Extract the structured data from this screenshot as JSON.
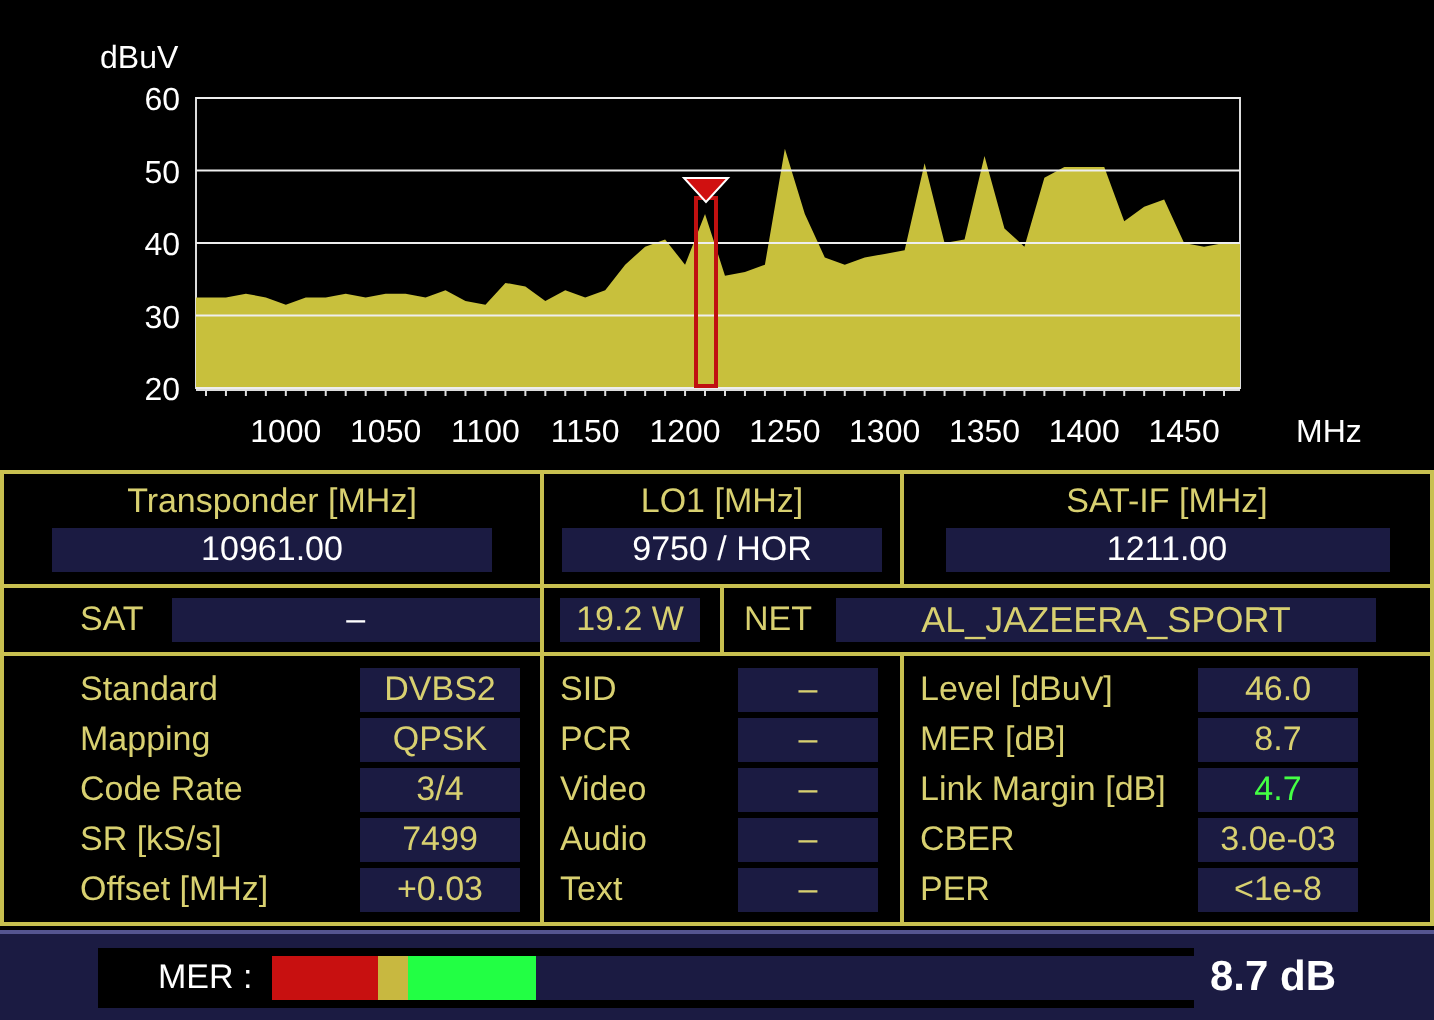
{
  "chart": {
    "chart_data": {
      "type": "area",
      "ylabel": "dBuV",
      "xlabel": "MHz",
      "x": [
        955,
        960,
        970,
        980,
        990,
        1000,
        1010,
        1020,
        1030,
        1040,
        1050,
        1060,
        1070,
        1080,
        1090,
        1100,
        1110,
        1120,
        1130,
        1140,
        1150,
        1160,
        1170,
        1180,
        1190,
        1200,
        1210,
        1220,
        1230,
        1240,
        1250,
        1260,
        1270,
        1280,
        1290,
        1300,
        1310,
        1320,
        1330,
        1340,
        1350,
        1360,
        1370,
        1380,
        1390,
        1400,
        1410,
        1420,
        1430,
        1440,
        1450,
        1460,
        1470,
        1478
      ],
      "series": [
        {
          "color": "#c8c03c",
          "values": [
            32.5,
            32.5,
            32.5,
            33,
            32.5,
            31.5,
            32.5,
            32.5,
            33,
            32.5,
            33,
            33,
            32.5,
            33.5,
            32,
            31.5,
            34.5,
            34,
            32,
            33.5,
            32.5,
            33.5,
            37,
            39.5,
            40.5,
            37,
            44,
            35.5,
            36,
            37,
            53,
            44,
            38,
            37,
            38,
            38.5,
            39,
            51,
            40,
            40.5,
            52,
            42,
            39.5,
            49,
            50.5,
            50.5,
            50.5,
            43,
            45,
            46,
            40,
            39.5,
            40,
            40
          ]
        }
      ],
      "grid": true,
      "xlim": [
        955,
        1478
      ],
      "ylim": [
        20,
        60
      ],
      "xticks": [
        1000,
        1050,
        1100,
        1150,
        1200,
        1250,
        1300,
        1350,
        1400,
        1450
      ],
      "yticks": [
        20,
        30,
        40,
        50,
        60
      ]
    }
  },
  "tuning": [
    {
      "label": "Transponder [MHz]",
      "value": "10961.00"
    },
    {
      "label": "LO1 [MHz]",
      "value": "9750 / HOR"
    },
    {
      "label": "SAT-IF [MHz]",
      "value": "1211.00"
    }
  ],
  "sat": {
    "label": "SAT",
    "value": "–",
    "position": "19.2 W"
  },
  "net": {
    "label": "NET",
    "value": "AL_JAZEERA_SPORT"
  },
  "signal": [
    [
      {
        "label": "Standard",
        "value": "DVBS2",
        "good": false
      },
      {
        "label": "Mapping",
        "value": "QPSK",
        "good": false
      },
      {
        "label": "Code Rate",
        "value": "3/4",
        "good": false
      },
      {
        "label": "SR [kS/s]",
        "value": "7499",
        "good": false
      },
      {
        "label": "Offset [MHz]",
        "value": "+0.03",
        "good": false
      }
    ],
    [
      {
        "label": "SID",
        "value": "–",
        "good": false
      },
      {
        "label": "PCR",
        "value": "–",
        "good": false
      },
      {
        "label": "Video",
        "value": "–",
        "good": false
      },
      {
        "label": "Audio",
        "value": "–",
        "good": false
      },
      {
        "label": "Text",
        "value": "–",
        "good": false
      }
    ],
    [
      {
        "label": "Level [dBuV]",
        "value": "46.0",
        "good": false
      },
      {
        "label": "MER [dB]",
        "value": "8.7",
        "good": false
      },
      {
        "label": "Link Margin [dB]",
        "value": "4.7",
        "good": true
      },
      {
        "label": "CBER",
        "value": "3.0e-03",
        "good": false
      },
      {
        "label": "PER",
        "value": "<1e-8",
        "good": false
      }
    ]
  ],
  "mer": {
    "label": "MER :",
    "level": 0.285,
    "reading": "8.7 dB"
  }
}
